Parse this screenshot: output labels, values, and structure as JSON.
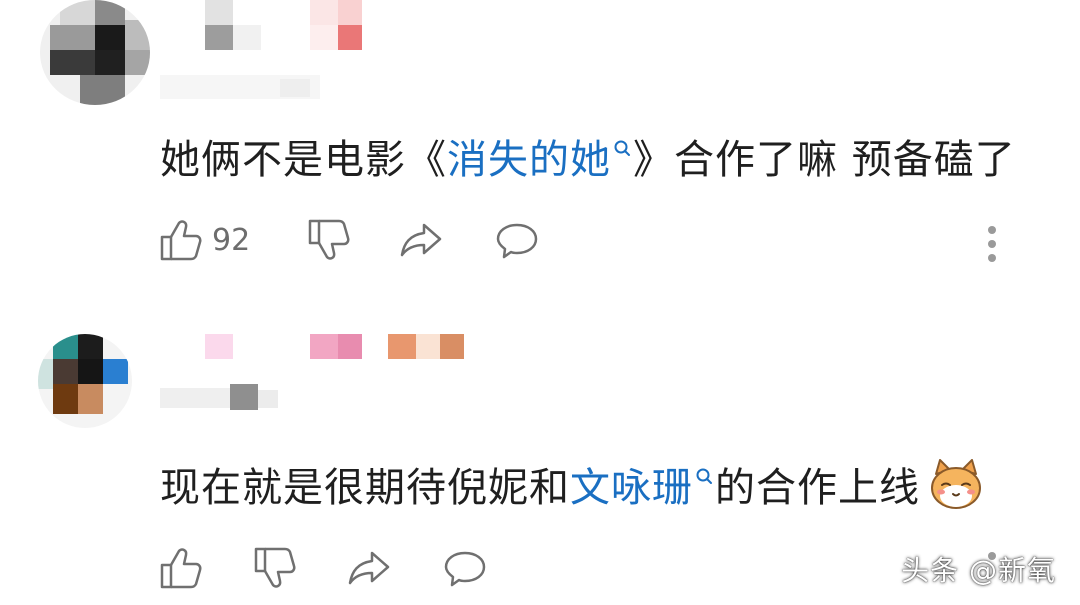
{
  "comments": [
    {
      "text_before": "她俩不是电影《",
      "link_text": "消失的她",
      "text_after": "》合作了嘛 预备磕了",
      "like_count": "92"
    },
    {
      "text_before": "现在就是很期待倪妮和",
      "link_text": "文咏珊",
      "text_after": "的合作上线",
      "like_count": ""
    }
  ],
  "watermark": "头条 @新氧",
  "colors": {
    "link": "#1a6fc2",
    "icon": "#707070",
    "text": "#1f1f1f"
  },
  "icons": [
    "thumbs-up-icon",
    "thumbs-down-icon",
    "share-icon",
    "reply-icon",
    "more-icon",
    "search-icon",
    "emoji-icon"
  ]
}
